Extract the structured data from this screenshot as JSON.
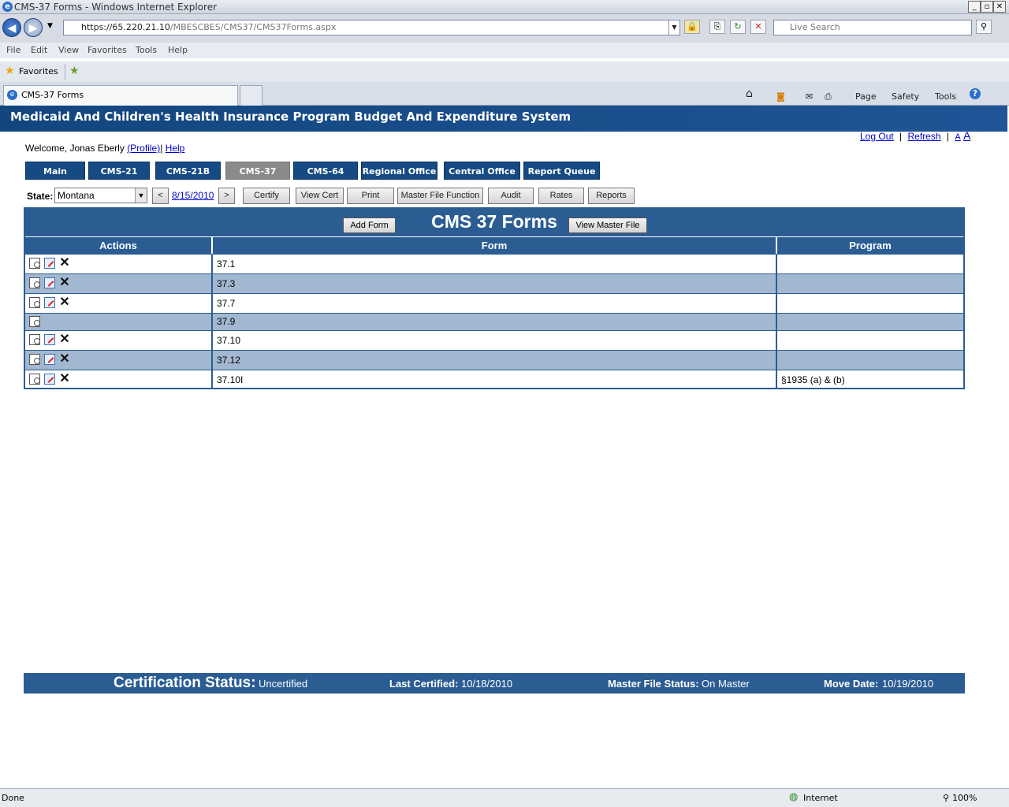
{
  "window": {
    "title": "CMS-37 Forms - Windows Internet Explorer"
  },
  "browser": {
    "url_host": "https://65.220.21.10",
    "url_path": "/MBESCBES/CMS37/CMS37Forms.aspx",
    "search_placeholder": "Live Search",
    "menu": [
      "File",
      "Edit",
      "View",
      "Favorites",
      "Tools",
      "Help"
    ],
    "favorites_label": "Favorites",
    "tab_title": "CMS-37 Forms",
    "commands": [
      "Page",
      "Safety",
      "Tools"
    ]
  },
  "banner": {
    "title": "Medicaid And Children's Health Insurance Program Budget And Expenditure System"
  },
  "user": {
    "welcome": "Welcome, Jonas Eberly",
    "profile_link": "(Profile)",
    "sep": "|",
    "help_link": "Help"
  },
  "top_links": {
    "logout": "Log Out",
    "refresh": "Refresh"
  },
  "nav_tabs": [
    "Main",
    "CMS-21",
    "CMS-21B",
    "CMS-37",
    "CMS-64",
    "Regional Office",
    "Central Office",
    "Report Queue"
  ],
  "toolbar": {
    "state_label": "State:",
    "state_value": "Montana",
    "prev": "<",
    "date": "8/15/2010",
    "next": ">",
    "buttons": [
      "Certify",
      "View Cert",
      "Print",
      "Master File Function",
      "Audit",
      "Rates",
      "Reports"
    ]
  },
  "grid": {
    "title": "CMS 37 Forms",
    "add_form": "Add Form",
    "view_master": "View Master File",
    "columns": [
      "Actions",
      "Form",
      "Program"
    ],
    "rows": [
      {
        "form": "37.1",
        "program": ""
      },
      {
        "form": "37.3",
        "program": ""
      },
      {
        "form": "37.7",
        "program": ""
      },
      {
        "form": "37.9",
        "program": ""
      },
      {
        "form": "37.10",
        "program": ""
      },
      {
        "form": "37.12",
        "program": ""
      },
      {
        "form": "37.10I",
        "program": "§1935 (a) & (b)"
      }
    ]
  },
  "status": {
    "cert_label": "Certification Status:",
    "cert_value": "Uncertified",
    "last_label": "Last Certified:",
    "last_value": "10/18/2010",
    "master_label": "Master File Status:",
    "master_value": "On Master",
    "move_label": "Move Date:",
    "move_value": "10/19/2010"
  },
  "ie_status": {
    "left": "Done",
    "zone": "Internet",
    "zoom": "100%"
  }
}
